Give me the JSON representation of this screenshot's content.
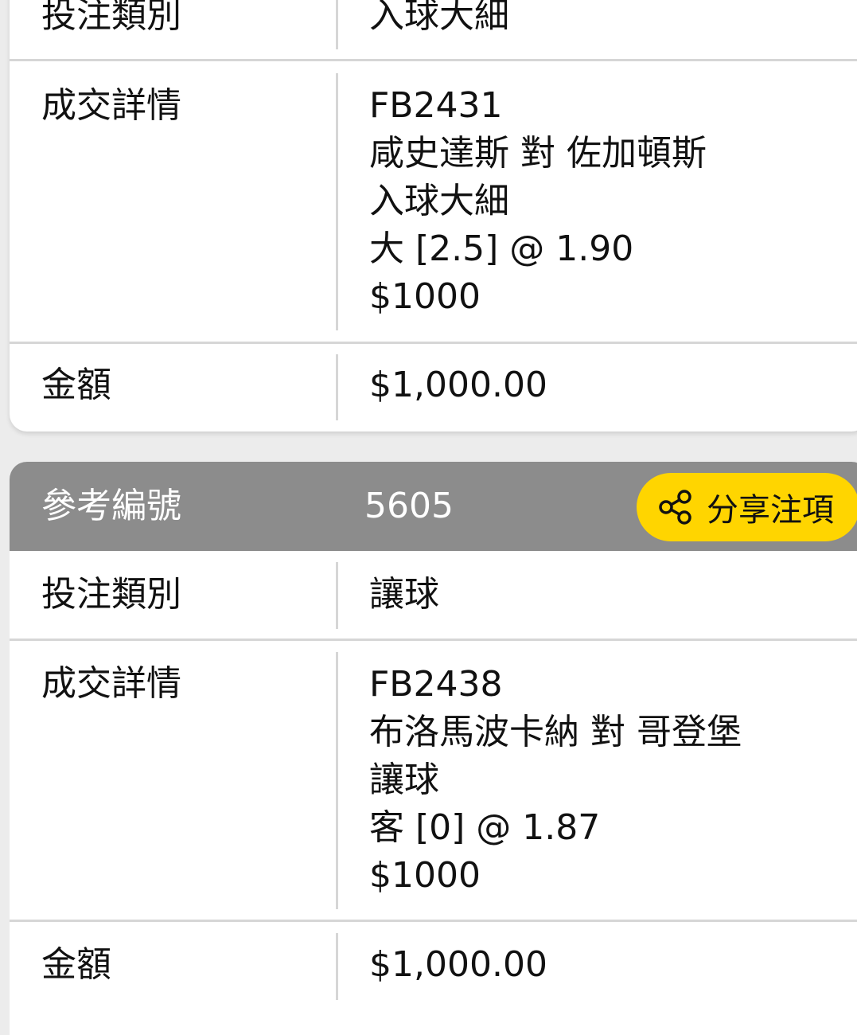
{
  "bets": [
    {
      "bet_type_label": "投注類別",
      "bet_type_value": "入球大細",
      "details_label": "成交詳情",
      "details": [
        "FB2431",
        "咸史達斯 對 佐加頓斯",
        "入球大細",
        "大 [2.5] @ 1.90",
        "$1000"
      ],
      "amount_label": "金額",
      "amount_value": "$1,000.00"
    },
    {
      "ref_label": "參考編號",
      "ref_value": "5605",
      "share_label": "分享注項",
      "bet_type_label": "投注類別",
      "bet_type_value": "讓球",
      "details_label": "成交詳情",
      "details": [
        "FB2438",
        "布洛馬波卡納 對 哥登堡",
        "讓球",
        "客 [0] @ 1.87",
        "$1000"
      ],
      "amount_label": "金額",
      "amount_value": "$1,000.00"
    }
  ],
  "colors": {
    "header_bg": "#8c8c8c",
    "share_button_bg": "#ffd500",
    "divider": "#d6d6d6"
  },
  "icons": {
    "share": "share-icon"
  }
}
